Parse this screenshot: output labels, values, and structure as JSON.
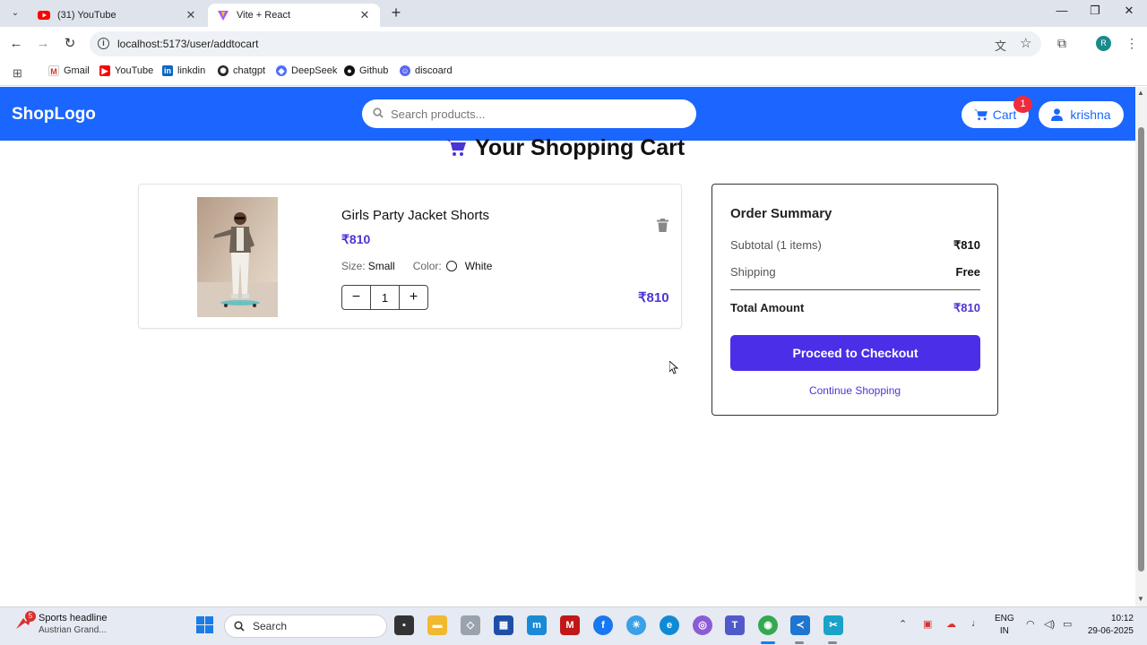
{
  "browser": {
    "tabs": [
      {
        "title": "(31) YouTube",
        "active": false
      },
      {
        "title": "Vite + React",
        "active": true
      }
    ],
    "url": "localhost:5173/user/addtocart",
    "profile_initial": "R",
    "bookmarks": [
      {
        "label": "Gmail",
        "icon": "gmail-icon"
      },
      {
        "label": "YouTube",
        "icon": "youtube-icon"
      },
      {
        "label": "linkdin",
        "icon": "linkedin-icon"
      },
      {
        "label": "chatgpt",
        "icon": "chatgpt-icon"
      },
      {
        "label": "DeepSeek",
        "icon": "deepseek-icon"
      },
      {
        "label": "Github",
        "icon": "github-icon"
      },
      {
        "label": "discoard",
        "icon": "discord-icon"
      }
    ]
  },
  "header": {
    "logo": "ShopLogo",
    "search_placeholder": "Search products...",
    "cart_label": "Cart",
    "cart_count": "1",
    "user_name": "krishna"
  },
  "page": {
    "title": "Your Shopping Cart"
  },
  "cart": {
    "items": [
      {
        "name": "Girls Party Jacket Shorts",
        "price": "₹810",
        "size_label": "Size:",
        "size": "Small",
        "color_label": "Color:",
        "color": "White",
        "quantity": "1",
        "line_total": "₹810"
      }
    ]
  },
  "summary": {
    "title": "Order Summary",
    "subtotal_label": "Subtotal (1 items)",
    "subtotal": "₹810",
    "shipping_label": "Shipping",
    "shipping": "Free",
    "total_label": "Total Amount",
    "total": "₹810",
    "checkout_label": "Proceed to Checkout",
    "continue_label": "Continue Shopping"
  },
  "taskbar": {
    "news_badge": "5",
    "news_headline": "Sports headline",
    "news_sub": "Austrian Grand...",
    "search_label": "Search",
    "lang_top": "ENG",
    "lang_bottom": "IN",
    "time": "10:12",
    "date": "29-06-2025"
  },
  "colors": {
    "header_blue": "#1a66ff",
    "accent_purple": "#4a2ee8",
    "badge_red": "#ef2b3d"
  }
}
